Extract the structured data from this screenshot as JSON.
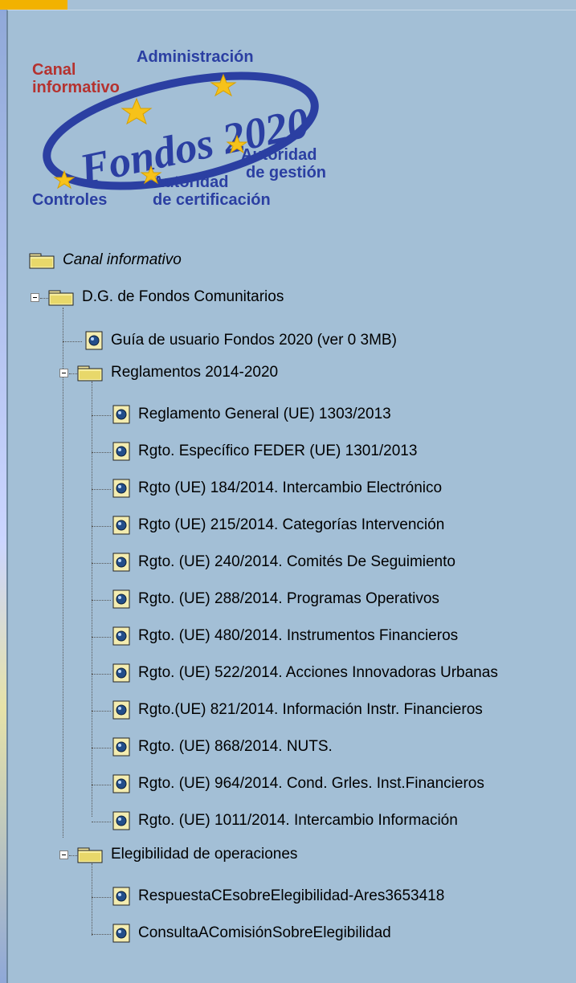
{
  "logo": {
    "center_text": "Fondos 2020",
    "labels": {
      "top": "Administración",
      "left_line1": "Canal",
      "left_line2": "informativo",
      "right_line1": "Autoridad",
      "right_line2": "de gestión",
      "bottom_mid_line1": "Autoridad",
      "bottom_mid_line2": "de certificación",
      "bottom_left": "Controles"
    }
  },
  "tree": {
    "root": "Canal informativo",
    "dg": "D.G. de Fondos Comunitarios",
    "guide": "Guía de usuario Fondos 2020 (ver 0 3MB)",
    "reg_folder": "Reglamentos 2014-2020",
    "reg_items": [
      "Reglamento General (UE) 1303/2013",
      "Rgto. Específico FEDER (UE) 1301/2013",
      "Rgto (UE) 184/2014. Intercambio Electrónico",
      "Rgto (UE) 215/2014. Categorías Intervención",
      "Rgto. (UE) 240/2014. Comités De Seguimiento",
      "Rgto. (UE) 288/2014. Programas Operativos",
      "Rgto. (UE) 480/2014. Instrumentos Financieros",
      "Rgto. (UE) 522/2014. Acciones Innovadoras Urbanas",
      "Rgto.(UE) 821/2014. Información Instr. Financieros",
      "Rgto. (UE) 868/2014. NUTS.",
      "Rgto. (UE) 964/2014. Cond. Grles. Inst.Financieros",
      "Rgto. (UE) 1011/2014. Intercambio Información"
    ],
    "elig_folder": "Elegibilidad de operaciones",
    "elig_items": [
      "RespuestaCEsobreElegibilidad-Ares3653418",
      "ConsultaAComisiónSobreElegibilidad"
    ]
  },
  "colors": {
    "panel_bg": "#a3bfd6",
    "accent_orange": "#f2b200",
    "logo_blue": "#2b3fa2",
    "logo_red": "#b5322f"
  }
}
